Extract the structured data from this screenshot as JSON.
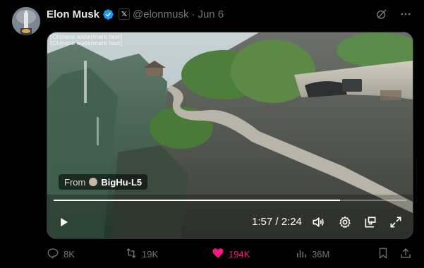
{
  "tweet": {
    "author_name": "Elon Musk",
    "handle": "@elonmusk",
    "separator": "·",
    "date": "Jun 6",
    "x_badge": "𝕏"
  },
  "media": {
    "watermark_line1": "[Chinese watermark text]",
    "watermark_line2": "[Chinese watermark text]",
    "from_label": "From",
    "from_author": "BigHu-L5",
    "time": "1:57 / 2:24",
    "progress": 0.8125
  },
  "actions": {
    "replies": "8K",
    "reposts": "19K",
    "likes": "194K",
    "views": "36M"
  },
  "icons": {
    "verified": "verified-badge-icon",
    "grok": "grok-icon",
    "more": "more-icon",
    "play": "play-icon",
    "volume": "volume-icon",
    "settings": "settings-icon",
    "pip": "picture-in-picture-icon",
    "fullscreen": "fullscreen-icon",
    "reply": "reply-icon",
    "repost": "repost-icon",
    "like": "heart-icon",
    "views": "views-icon",
    "bookmark": "bookmark-icon",
    "share": "share-icon"
  },
  "colors": {
    "background": "#000000",
    "text_primary": "#e7e9ea",
    "text_secondary": "#71767b",
    "verified_blue": "#1d9bf0",
    "like_pink": "#f91880"
  }
}
